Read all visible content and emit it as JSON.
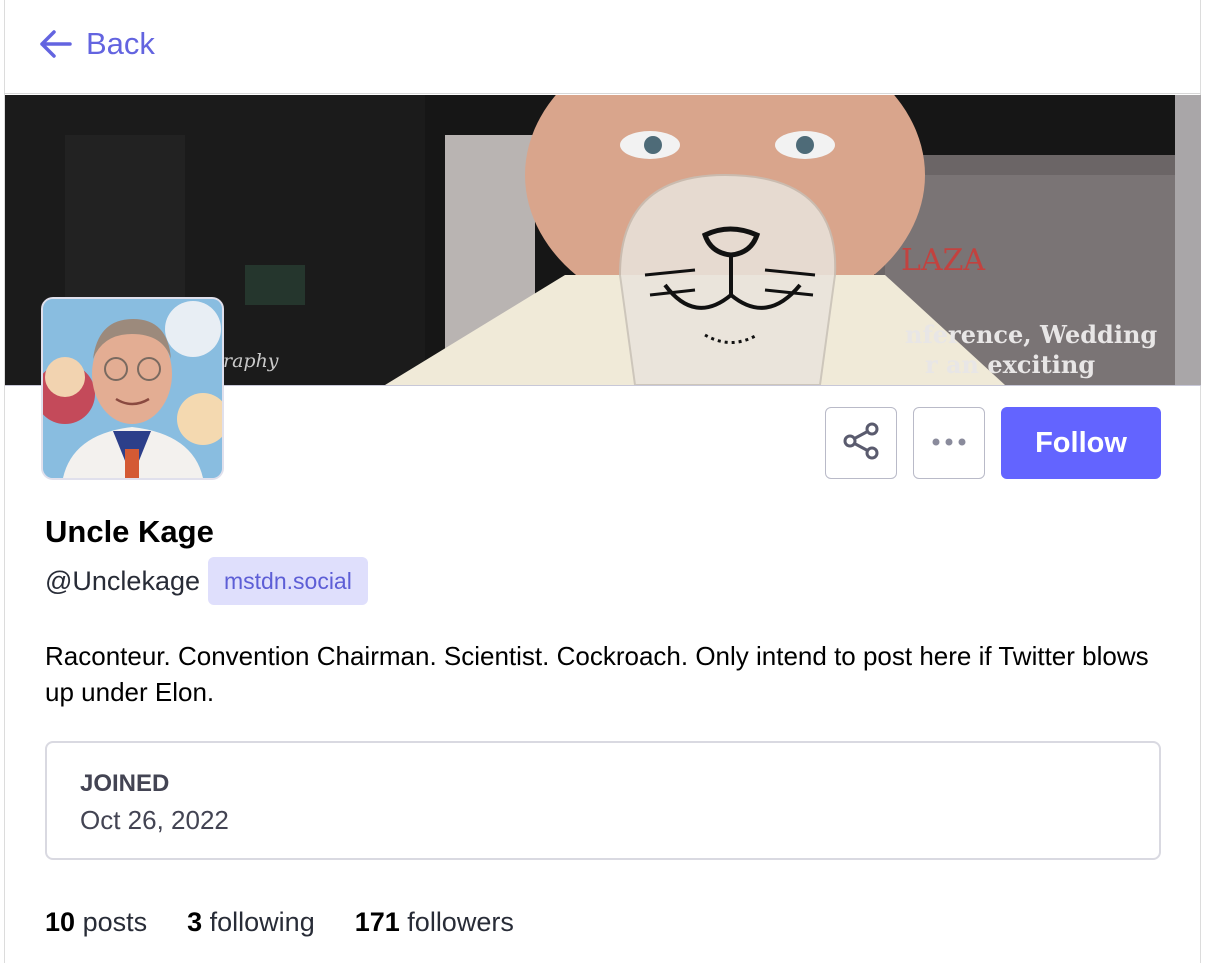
{
  "nav": {
    "back_label": "Back"
  },
  "banner": {
    "watermark": "raphy",
    "sign_text": "LAZA",
    "sign_subtext_1": "nference, Wedding",
    "sign_subtext_2": "r an exciting"
  },
  "profile": {
    "display_name": "Uncle Kage",
    "handle": "@Unclekage",
    "domain": "mstdn.social",
    "bio": "Raconteur. Convention Chairman. Scientist. Cockroach. Only intend to post here if Twitter blows up under Elon."
  },
  "actions": {
    "follow_label": "Follow"
  },
  "joined": {
    "label": "JOINED",
    "date": "Oct 26, 2022"
  },
  "stats": {
    "posts_count": "10",
    "posts_label": "posts",
    "following_count": "3",
    "following_label": "following",
    "followers_count": "171",
    "followers_label": "followers"
  },
  "colors": {
    "accent": "#6364ff",
    "link": "#6364e0",
    "domain_bg": "#dfdffc"
  }
}
